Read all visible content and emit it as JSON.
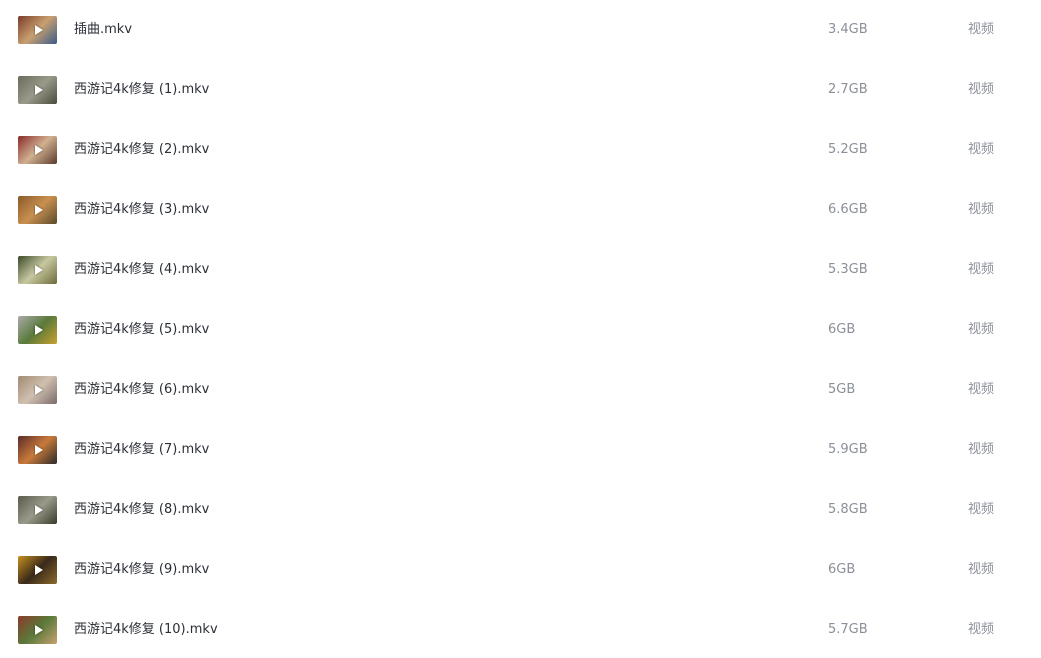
{
  "files": [
    {
      "name": "插曲.mkv",
      "size": "3.4GB",
      "type": "视频",
      "icon": "video-thumbnail-icon",
      "colors": [
        "#7a3a2a",
        "#c8a070",
        "#3a5a8a"
      ]
    },
    {
      "name": "西游记4k修复 (1).mkv",
      "size": "2.7GB",
      "type": "视频",
      "icon": "video-thumbnail-icon",
      "colors": [
        "#6a6a5a",
        "#9a9a8a",
        "#4a4a3a"
      ]
    },
    {
      "name": "西游记4k修复 (2).mkv",
      "size": "5.2GB",
      "type": "视频",
      "icon": "video-thumbnail-icon",
      "colors": [
        "#8a2a2a",
        "#d0b090",
        "#5a3a2a"
      ]
    },
    {
      "name": "西游记4k修复 (3).mkv",
      "size": "6.6GB",
      "type": "视频",
      "icon": "video-thumbnail-icon",
      "colors": [
        "#8a5a2a",
        "#c89050",
        "#5a4a2a"
      ]
    },
    {
      "name": "西游记4k修复 (4).mkv",
      "size": "5.3GB",
      "type": "视频",
      "icon": "video-thumbnail-icon",
      "colors": [
        "#3a4a2a",
        "#c8c8a0",
        "#6a6a3a"
      ]
    },
    {
      "name": "西游记4k修复 (5).mkv",
      "size": "6GB",
      "type": "视频",
      "icon": "video-thumbnail-icon",
      "colors": [
        "#aaaaaa",
        "#5a7a3a",
        "#c8a030"
      ]
    },
    {
      "name": "西游记4k修复 (6).mkv",
      "size": "5GB",
      "type": "视频",
      "icon": "video-thumbnail-icon",
      "colors": [
        "#a08a70",
        "#d0c0b0",
        "#7a6a6a"
      ]
    },
    {
      "name": "西游记4k修复 (7).mkv",
      "size": "5.9GB",
      "type": "视频",
      "icon": "video-thumbnail-icon",
      "colors": [
        "#5a2a2a",
        "#c87a3a",
        "#2a2a2a"
      ]
    },
    {
      "name": "西游记4k修复 (8).mkv",
      "size": "5.8GB",
      "type": "视频",
      "icon": "video-thumbnail-icon",
      "colors": [
        "#5a5a4a",
        "#9a9a8a",
        "#3a3a2a"
      ]
    },
    {
      "name": "西游记4k修复 (9).mkv",
      "size": "6GB",
      "type": "视频",
      "icon": "video-thumbnail-icon",
      "colors": [
        "#c89020",
        "#3a2a1a",
        "#8a6a2a"
      ]
    },
    {
      "name": "西游记4k修复 (10).mkv",
      "size": "5.7GB",
      "type": "视频",
      "icon": "video-thumbnail-icon",
      "colors": [
        "#8a3a2a",
        "#5a7a3a",
        "#c8a070"
      ]
    }
  ]
}
